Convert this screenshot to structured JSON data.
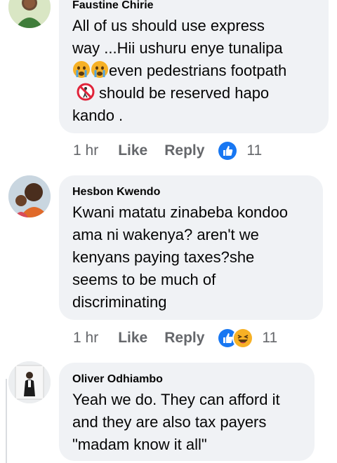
{
  "comments": [
    {
      "author": "Faustine Chirie",
      "lines": [
        "All of us should use express",
        "way ...Hii ushuru enye tunalipa",
        "even pedestrians footpath",
        "should be reserved hapo",
        "kando ."
      ],
      "inline_emoji": [
        "crying-face",
        "crying-face",
        "no-pedestrians"
      ],
      "time": "1 hr",
      "like_label": "Like",
      "reply_label": "Reply",
      "reactions": [
        "like"
      ],
      "reaction_count": "11"
    },
    {
      "author": "Hesbon Kwendo",
      "lines": [
        "Kwani matatu zinabeba kondoo",
        "ama ni wakenya? aren't we",
        "kenyans paying taxes?she",
        "seems to be much of",
        "discriminating"
      ],
      "time": "1 hr",
      "like_label": "Like",
      "reply_label": "Reply",
      "reactions": [
        "like",
        "haha"
      ],
      "reaction_count": "11"
    },
    {
      "author": "Oliver Odhiambo",
      "lines": [
        "Yeah we do. They can afford it",
        "and they are also tax payers",
        "\"madam know it all\""
      ]
    }
  ],
  "colors": {
    "bubble": "#f0f2f5",
    "meta_text": "#65676b",
    "like_blue": "#1877f2",
    "haha_yellow": "#f7b125"
  }
}
